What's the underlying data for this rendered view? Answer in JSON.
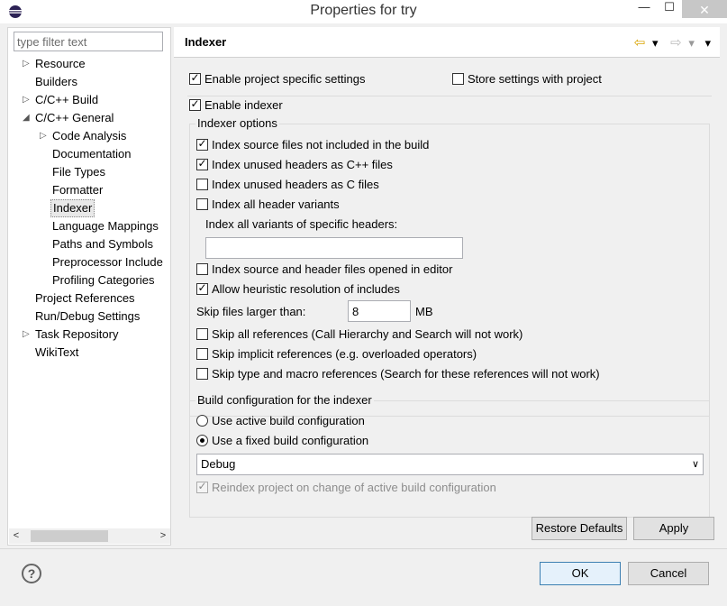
{
  "window": {
    "title": "Properties for try",
    "min_glyph": "—",
    "max_glyph": "☐",
    "close_glyph": "✕"
  },
  "filter": {
    "placeholder": "type filter text",
    "value": ""
  },
  "tree": [
    {
      "label": "Resource",
      "expander": "▷"
    },
    {
      "label": "Builders",
      "expander": ""
    },
    {
      "label": "C/C++ Build",
      "expander": "▷"
    },
    {
      "label": "C/C++ General",
      "expander": "◢"
    },
    {
      "label": "Code Analysis",
      "expander": "▷"
    },
    {
      "label": "Documentation",
      "expander": ""
    },
    {
      "label": "File Types",
      "expander": ""
    },
    {
      "label": "Formatter",
      "expander": ""
    },
    {
      "label": "Indexer",
      "expander": "",
      "selected": true
    },
    {
      "label": "Language Mappings",
      "expander": ""
    },
    {
      "label": "Paths and Symbols",
      "expander": ""
    },
    {
      "label": "Preprocessor Include",
      "expander": ""
    },
    {
      "label": "Profiling Categories",
      "expander": ""
    },
    {
      "label": "Project References",
      "expander": ""
    },
    {
      "label": "Run/Debug Settings",
      "expander": ""
    },
    {
      "label": "Task Repository",
      "expander": "▷"
    },
    {
      "label": "WikiText",
      "expander": ""
    }
  ],
  "scroll": {
    "left": "<",
    "right": ">"
  },
  "page": {
    "title": "Indexer",
    "nav": {
      "back": "⇦",
      "back_menu": "▾",
      "forward": "⇨",
      "forward_menu": "▾",
      "view_menu": "▾"
    }
  },
  "settings": {
    "enable_project_specific": {
      "label": "Enable project specific settings",
      "checked": true
    },
    "store_with_project": {
      "label": "Store settings with project",
      "checked": false
    },
    "enable_indexer": {
      "label": "Enable indexer",
      "checked": true
    },
    "indexer_options_label": "Indexer options",
    "index_source_not_in_build": {
      "label": "Index source files not included in the build",
      "checked": true
    },
    "index_unused_cpp": {
      "label": "Index unused headers as C++ files",
      "checked": true
    },
    "index_unused_c": {
      "label": "Index unused headers as C files",
      "checked": false
    },
    "index_all_header_variants": {
      "label": "Index all header variants",
      "checked": false
    },
    "variants_specific_label": "Index all variants of specific headers:",
    "variants_specific_value": "",
    "index_opened_in_editor": {
      "label": "Index source and header files opened in editor",
      "checked": false
    },
    "heuristic_resolution": {
      "label": "Allow heuristic resolution of includes",
      "checked": true
    },
    "skip_larger_label": "Skip files larger than:",
    "skip_larger_value": "8",
    "skip_larger_unit": "MB",
    "skip_all_refs": {
      "label": "Skip all references (Call Hierarchy and Search will not work)",
      "checked": false
    },
    "skip_implicit_refs": {
      "label": "Skip implicit references (e.g. overloaded operators)",
      "checked": false
    },
    "skip_type_macro_refs": {
      "label": "Skip type and macro references (Search for these references will not work)",
      "checked": false
    },
    "build_config_label": "Build configuration for the indexer",
    "use_active_config": {
      "label": "Use active build configuration",
      "selected": false
    },
    "use_fixed_config": {
      "label": "Use a fixed build configuration",
      "selected": true
    },
    "fixed_config_value": "Debug",
    "reindex_on_change": {
      "label": "Reindex project on change of active build configuration",
      "checked": true,
      "disabled": true
    }
  },
  "buttons": {
    "restore_defaults": "Restore Defaults",
    "apply": "Apply",
    "ok": "OK",
    "cancel": "Cancel",
    "help": "?"
  },
  "colors": {
    "selection_bg": "#e8e8e8",
    "default_button_border": "#3c7fb1",
    "close_button_bg": "#c7c7c7"
  }
}
